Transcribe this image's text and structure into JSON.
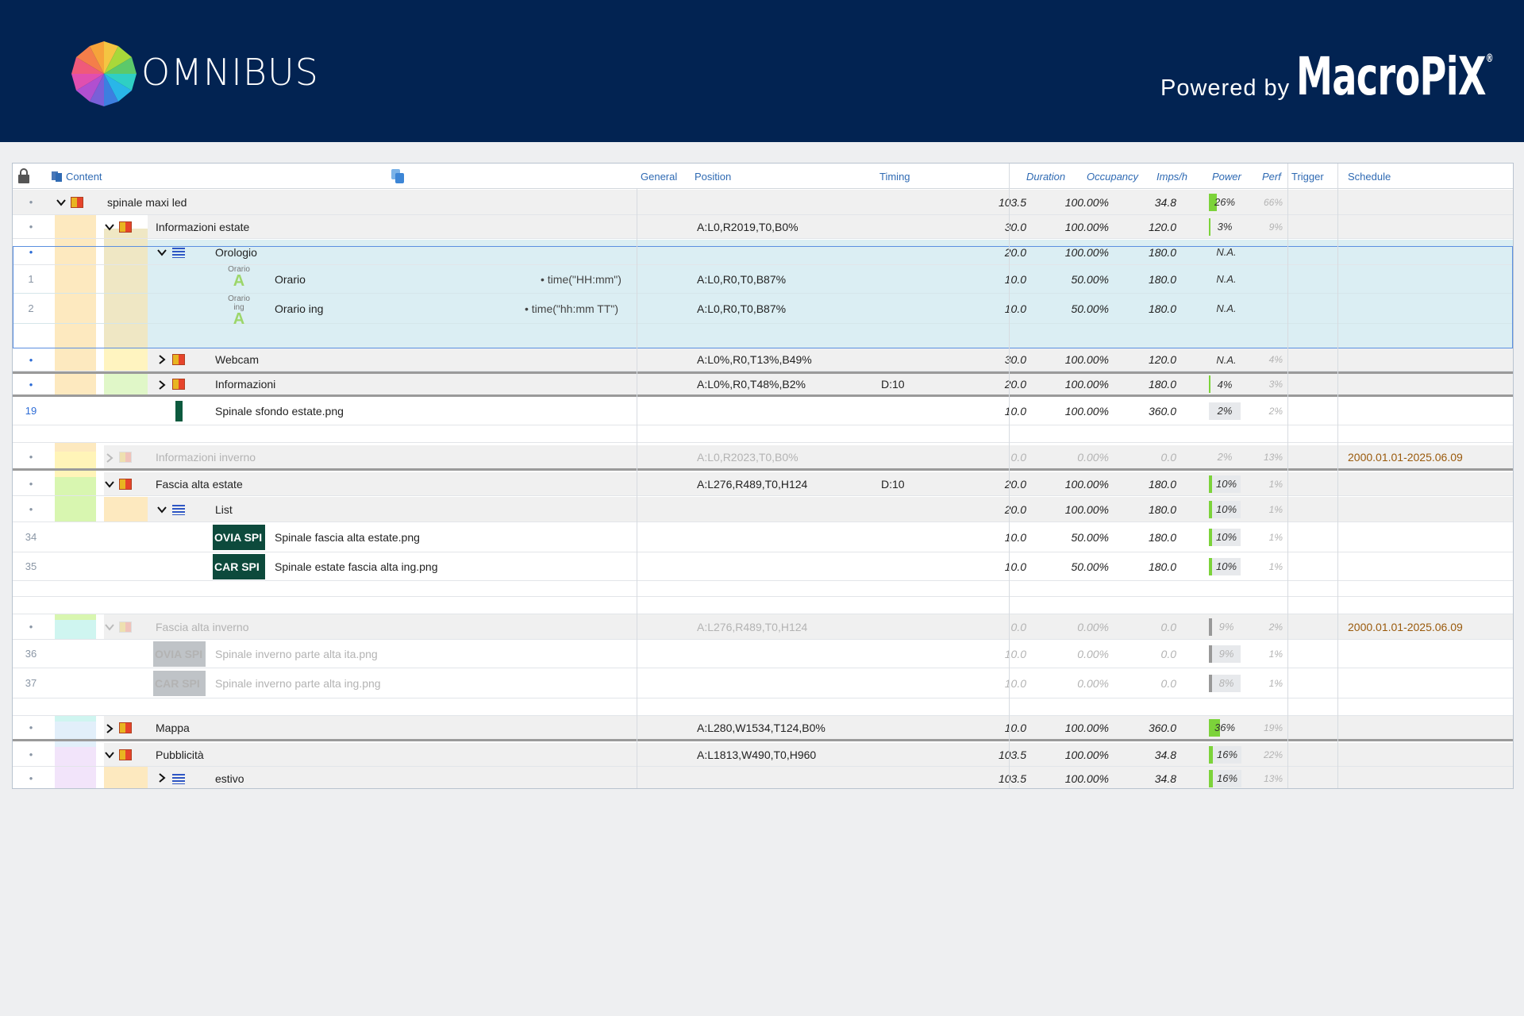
{
  "header": {
    "logo_text": "OMNIBUS",
    "powered_by": "Powered by",
    "brand": "MacroPiX",
    "brand_mark": "®",
    "bg_color": "#022352"
  },
  "columns": {
    "content": "Content",
    "general": "General",
    "position": "Position",
    "timing": "Timing",
    "duration": "Duration",
    "occupancy": "Occupancy",
    "imps": "Imps/h",
    "power": "Power",
    "perf": "Perf",
    "trigger": "Trigger",
    "schedule": "Schedule"
  },
  "rows": {
    "r1": {
      "name": "spinale maxi led",
      "duration": "103.5",
      "occ": "100.00%",
      "imps": "34.8",
      "power": "26%",
      "power_level": 26,
      "perf": "66%"
    },
    "r2": {
      "name": "Informazioni estate",
      "pos": "A:L0,R2019,T0,B0%",
      "duration": "30.0",
      "occ": "100.00%",
      "imps": "120.0",
      "power": "3%",
      "power_level": 3,
      "perf": "9%"
    },
    "r3": {
      "name": "Orologio",
      "duration": "20.0",
      "occ": "100.00%",
      "imps": "180.0",
      "power": "N.A."
    },
    "r4": {
      "idx": "1",
      "icon_label": "Orario",
      "name": "Orario",
      "general": "• time(\"HH:mm\")",
      "pos": "A:L0,R0,T0,B87%",
      "duration": "10.0",
      "occ": "50.00%",
      "imps": "180.0",
      "power": "N.A."
    },
    "r5": {
      "idx": "2",
      "icon_label": "Orario ing",
      "name": "Orario ing",
      "general": "• time(\"hh:mm TT\")",
      "pos": "A:L0,R0,T0,B87%",
      "duration": "10.0",
      "occ": "50.00%",
      "imps": "180.0",
      "power": "N.A."
    },
    "r6": {
      "name": "Webcam",
      "pos": "A:L0%,R0,T13%,B49%",
      "duration": "30.0",
      "occ": "100.00%",
      "imps": "120.0",
      "power": "N.A.",
      "perf": "4%"
    },
    "r7": {
      "name": "Informazioni",
      "pos": "A:L0%,R0,T48%,B2%",
      "timing": "D:10",
      "duration": "20.0",
      "occ": "100.00%",
      "imps": "180.0",
      "power": "4%",
      "power_level": 4,
      "perf": "3%"
    },
    "r8": {
      "idx": "19",
      "name": "Spinale sfondo estate.png",
      "duration": "10.0",
      "occ": "100.00%",
      "imps": "360.0",
      "power": "2%",
      "perf": "2%"
    },
    "r9": {
      "name": "Informazioni inverno",
      "pos": "A:L0,R2023,T0,B0%",
      "duration": "0.0",
      "occ": "0.00%",
      "imps": "0.0",
      "power": "2%",
      "perf": "13%",
      "schedule": "2000.01.01-2025.06.09"
    },
    "r10": {
      "name": "Fascia alta estate",
      "pos": "A:L276,R489,T0,H124",
      "timing": "D:10",
      "duration": "20.0",
      "occ": "100.00%",
      "imps": "180.0",
      "power": "10%",
      "power_level": 10,
      "perf": "1%"
    },
    "r11": {
      "name": "List",
      "duration": "20.0",
      "occ": "100.00%",
      "imps": "180.0",
      "power": "10%",
      "power_level": 10,
      "perf": "1%"
    },
    "r12": {
      "idx": "34",
      "thumb": "OVIA SPI",
      "name": "Spinale fascia alta estate.png",
      "duration": "10.0",
      "occ": "50.00%",
      "imps": "180.0",
      "power": "10%",
      "power_level": 10,
      "perf": "1%"
    },
    "r13": {
      "idx": "35",
      "thumb": "CAR SPI",
      "name": "Spinale estate fascia alta ing.png",
      "duration": "10.0",
      "occ": "50.00%",
      "imps": "180.0",
      "power": "10%",
      "power_level": 10,
      "perf": "1%"
    },
    "r14": {
      "name": "Fascia alta inverno",
      "pos": "A:L276,R489,T0,H124",
      "duration": "0.0",
      "occ": "0.00%",
      "imps": "0.0",
      "power": "9%",
      "power_level": 9,
      "perf": "2%",
      "schedule": "2000.01.01-2025.06.09"
    },
    "r15": {
      "idx": "36",
      "thumb": "OVIA SPI",
      "name": "Spinale inverno parte alta ita.png",
      "duration": "10.0",
      "occ": "0.00%",
      "imps": "0.0",
      "power": "9%",
      "power_level": 9,
      "perf": "1%"
    },
    "r16": {
      "idx": "37",
      "thumb": "CAR SPI",
      "name": "Spinale inverno parte alta ing.png",
      "duration": "10.0",
      "occ": "0.00%",
      "imps": "0.0",
      "power": "8%",
      "power_level": 8,
      "perf": "1%"
    },
    "r17": {
      "name": "Mappa",
      "pos": "A:L280,W1534,T124,B0%",
      "duration": "10.0",
      "occ": "100.00%",
      "imps": "360.0",
      "power": "36%",
      "power_level": 36,
      "perf": "19%"
    },
    "r18": {
      "name": "Pubblicità",
      "pos": "A:L1813,W490,T0,H960",
      "duration": "103.5",
      "occ": "100.00%",
      "imps": "34.8",
      "power": "16%",
      "power_level": 16,
      "perf": "22%"
    },
    "r19": {
      "name": "estivo",
      "duration": "103.5",
      "occ": "100.00%",
      "imps": "34.8",
      "power": "16%",
      "power_level": 16,
      "perf": "13%"
    }
  },
  "bullet": "•"
}
